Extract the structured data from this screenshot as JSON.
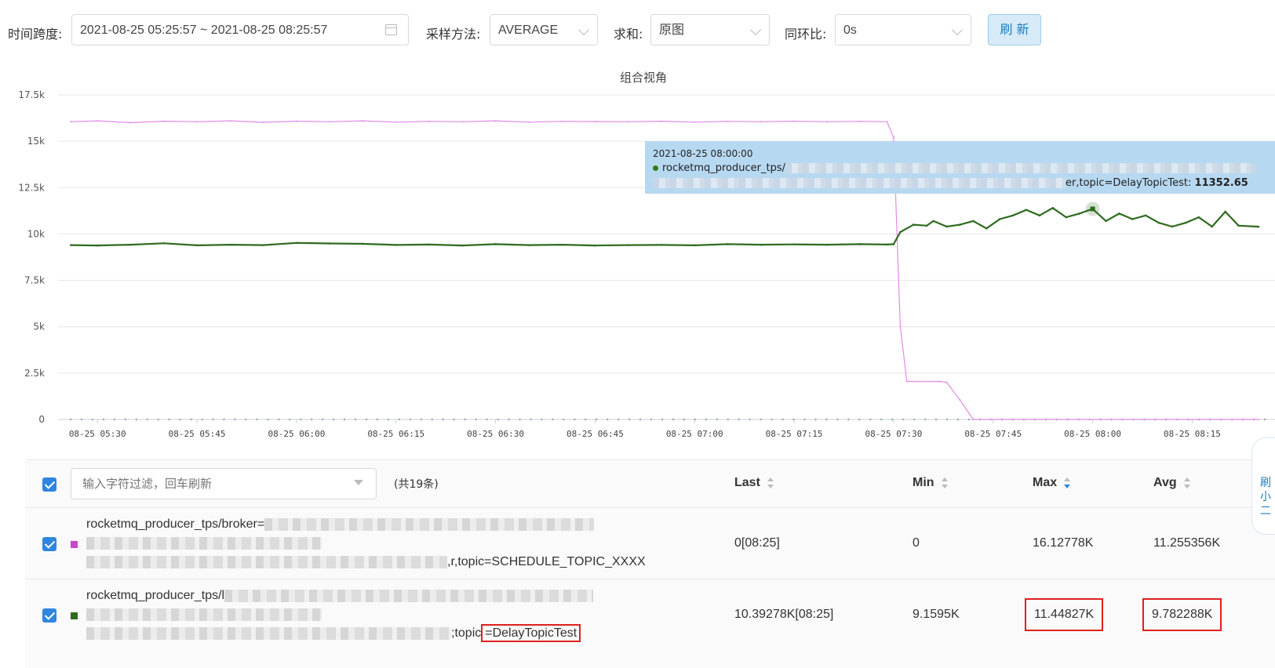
{
  "toolbar": {
    "time_span_label": "时间跨度:",
    "time_range": "2021-08-25 05:25:57 ~ 2021-08-25 08:25:57",
    "sampling_label": "采样方法:",
    "sampling_value": "AVERAGE",
    "sum_label": "求和:",
    "sum_value": "原图",
    "yoy_label": "同环比:",
    "yoy_value": "0s",
    "refresh_label": "刷 新"
  },
  "chart_data": {
    "type": "line",
    "title": "组合视角",
    "ylim": [
      0,
      17500
    ],
    "y_ticks": [
      "0",
      "2.5k",
      "5k",
      "7.5k",
      "10k",
      "12.5k",
      "15k",
      "17.5k"
    ],
    "x_ticks": [
      "08-25 05:30",
      "08-25 05:45",
      "08-25 06:00",
      "08-25 06:15",
      "08-25 06:30",
      "08-25 06:45",
      "08-25 07:00",
      "08-25 07:15",
      "08-25 07:30",
      "08-25 07:45",
      "08-25 08:00",
      "08-25 08:15"
    ],
    "series": [
      {
        "name": "rocketmq_producer_tps/broker=…,topic=SCHEDULE_TOPIC_XXXX",
        "color": "#e18be8",
        "points": [
          [
            "05:26",
            16050
          ],
          [
            "05:30",
            16100
          ],
          [
            "05:35",
            16000
          ],
          [
            "05:40",
            16080
          ],
          [
            "05:45",
            16050
          ],
          [
            "05:50",
            16100
          ],
          [
            "05:55",
            16020
          ],
          [
            "06:00",
            16080
          ],
          [
            "06:05",
            16050
          ],
          [
            "06:10",
            16100
          ],
          [
            "06:15",
            16030
          ],
          [
            "06:20",
            16070
          ],
          [
            "06:25",
            16050
          ],
          [
            "06:30",
            16100
          ],
          [
            "06:35",
            16030
          ],
          [
            "06:40",
            16070
          ],
          [
            "06:45",
            16060
          ],
          [
            "06:50",
            16050
          ],
          [
            "06:55",
            16080
          ],
          [
            "07:00",
            16030
          ],
          [
            "07:05",
            16070
          ],
          [
            "07:10",
            16050
          ],
          [
            "07:15",
            16080
          ],
          [
            "07:20",
            16050
          ],
          [
            "07:25",
            16070
          ],
          [
            "07:29",
            16050
          ],
          [
            "07:30",
            15200
          ],
          [
            "07:31",
            5000
          ],
          [
            "07:32",
            2050
          ],
          [
            "07:37",
            2050
          ],
          [
            "07:38",
            2000
          ],
          [
            "07:40",
            1050
          ],
          [
            "07:42",
            0
          ],
          [
            "08:25",
            0
          ]
        ]
      },
      {
        "name": "rocketmq_producer_tps/…,topic=DelayTopicTest",
        "color": "#2f6b1f",
        "points": [
          [
            "05:26",
            9400
          ],
          [
            "05:30",
            9380
          ],
          [
            "05:35",
            9420
          ],
          [
            "05:40",
            9500
          ],
          [
            "05:45",
            9390
          ],
          [
            "05:50",
            9420
          ],
          [
            "05:55",
            9400
          ],
          [
            "06:00",
            9520
          ],
          [
            "06:05",
            9490
          ],
          [
            "06:10",
            9470
          ],
          [
            "06:15",
            9410
          ],
          [
            "06:20",
            9430
          ],
          [
            "06:25",
            9380
          ],
          [
            "06:30",
            9450
          ],
          [
            "06:35",
            9400
          ],
          [
            "06:40",
            9420
          ],
          [
            "06:45",
            9380
          ],
          [
            "06:50",
            9400
          ],
          [
            "06:55",
            9410
          ],
          [
            "07:00",
            9390
          ],
          [
            "07:05",
            9450
          ],
          [
            "07:10",
            9420
          ],
          [
            "07:15",
            9440
          ],
          [
            "07:20",
            9420
          ],
          [
            "07:25",
            9450
          ],
          [
            "07:29",
            9430
          ],
          [
            "07:30",
            9450
          ],
          [
            "07:31",
            10100
          ],
          [
            "07:33",
            10500
          ],
          [
            "07:35",
            10450
          ],
          [
            "07:36",
            10700
          ],
          [
            "07:38",
            10400
          ],
          [
            "07:40",
            10500
          ],
          [
            "07:42",
            10700
          ],
          [
            "07:44",
            10300
          ],
          [
            "07:46",
            10800
          ],
          [
            "07:48",
            11000
          ],
          [
            "07:50",
            11300
          ],
          [
            "07:52",
            11000
          ],
          [
            "07:54",
            11400
          ],
          [
            "07:56",
            10900
          ],
          [
            "07:58",
            11100
          ],
          [
            "08:00",
            11352.65
          ],
          [
            "08:02",
            10700
          ],
          [
            "08:04",
            11100
          ],
          [
            "08:06",
            10800
          ],
          [
            "08:08",
            11000
          ],
          [
            "08:10",
            10600
          ],
          [
            "08:12",
            10400
          ],
          [
            "08:14",
            10600
          ],
          [
            "08:16",
            10900
          ],
          [
            "08:18",
            10400
          ],
          [
            "08:20",
            11200
          ],
          [
            "08:22",
            10450
          ],
          [
            "08:25",
            10392.78
          ]
        ]
      }
    ]
  },
  "tooltip": {
    "time": "2021-08-25 08:00:00",
    "line1_prefix": "rocketmq_producer_tps/",
    "line2_suffix": "er,topic=DelayTopicTest:",
    "value": "11352.65"
  },
  "legend_table": {
    "filter_placeholder": "输入字符过滤，回车刷新",
    "count_text": "(共19条)",
    "columns": {
      "last": "Last",
      "min": "Min",
      "max": "Max",
      "avg": "Avg"
    },
    "rows": [
      {
        "swatch_color": "#cc44cc",
        "name_line1": "rocketmq_producer_tps/broker=",
        "name_line3_suffix": ",r,topic=SCHEDULE_TOPIC_XXXX",
        "last": "0[08:25]",
        "min": "0",
        "max": "16.12778K",
        "avg": "11.255356K"
      },
      {
        "swatch_color": "#2f6b1f",
        "name_line1": "rocketmq_producer_tps/l",
        "name_line3_prefix": ";topic",
        "name_line3_highlight": "=DelayTopicTest",
        "last": "10.39278K[08:25]",
        "min": "9.1595K",
        "max": "11.44827K",
        "avg": "9.782288K"
      }
    ]
  },
  "side_float": {
    "text": "刷\n小\n二"
  }
}
